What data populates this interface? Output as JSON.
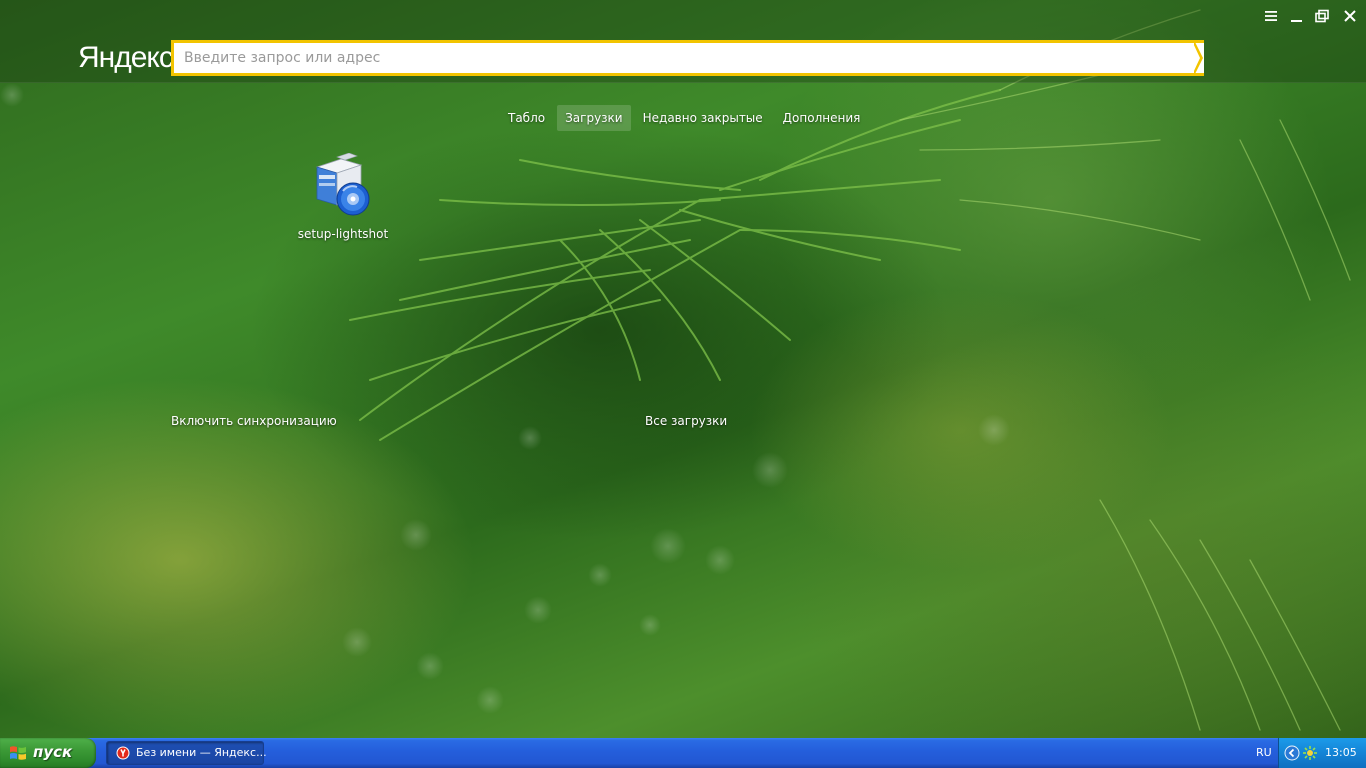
{
  "browser": {
    "logo_text": "Яндекс",
    "search": {
      "placeholder": "Введите запрос или адрес",
      "value": ""
    },
    "window_controls": {
      "menu_icon": "hamburger-icon",
      "minimize_icon": "minimize-icon",
      "restore_icon": "restore-icon",
      "close_icon": "close-icon"
    },
    "accent_color": "#f2c400"
  },
  "nav": {
    "tabs": [
      {
        "label": "Табло",
        "active": false
      },
      {
        "label": "Загрузки",
        "active": true
      },
      {
        "label": "Недавно закрытые",
        "active": false
      },
      {
        "label": "Дополнения",
        "active": false
      }
    ]
  },
  "downloads": {
    "items": [
      {
        "name": "setup-lightshot",
        "icon": "installer-box-disc-icon"
      }
    ],
    "all_downloads_label": "Все загрузки"
  },
  "sync": {
    "label": "Включить синхронизацию"
  },
  "taskbar": {
    "start_label": "пуск",
    "task_item_label": "Без имени — Яндекс...",
    "language": "RU",
    "clock": "13:05"
  }
}
